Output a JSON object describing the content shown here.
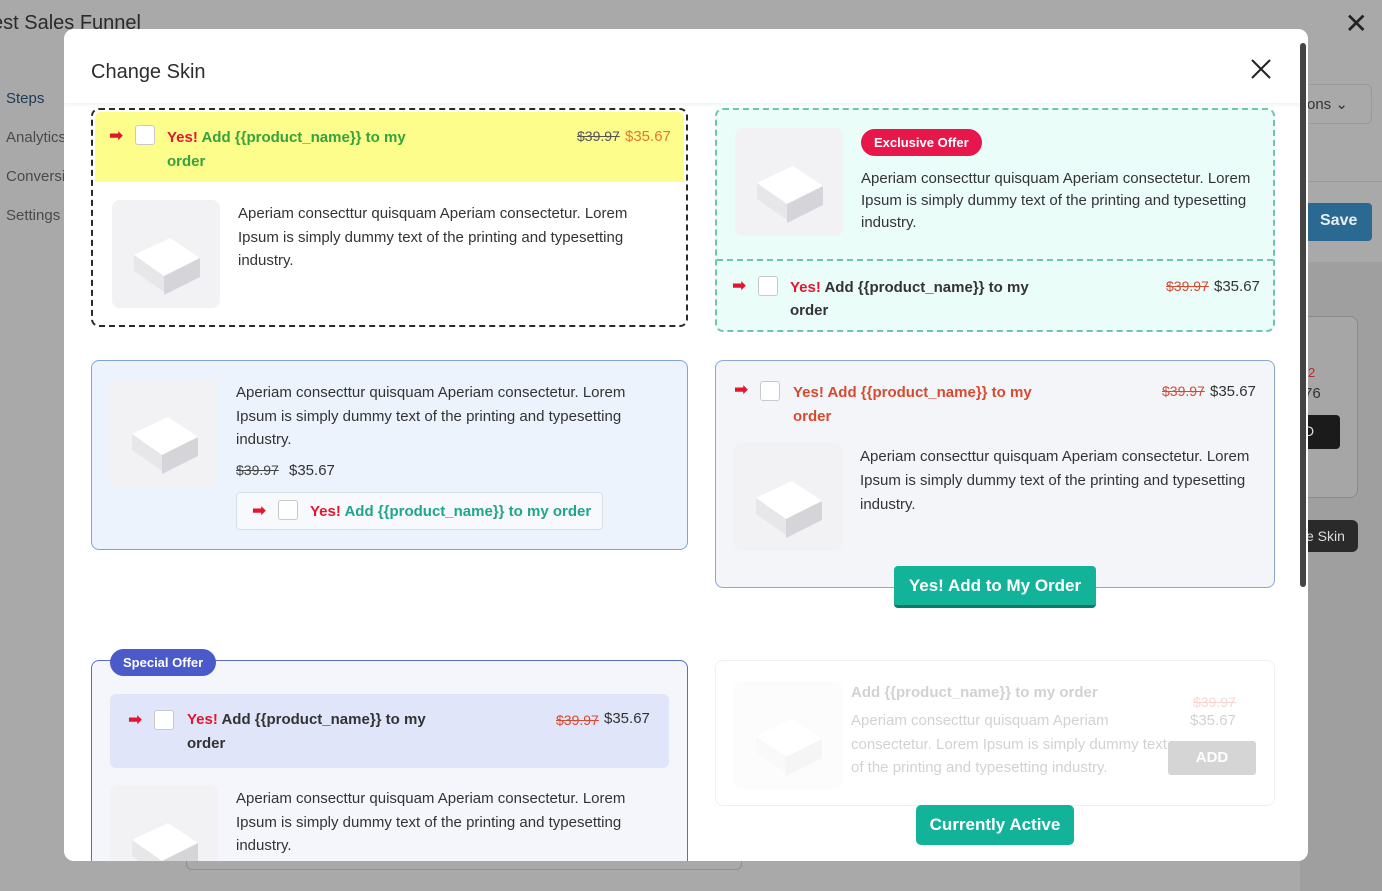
{
  "background": {
    "title": "est Sales Funnel",
    "nav": [
      "Steps",
      "Analytics",
      "Conversi",
      "Settings"
    ],
    "select_label": "ons",
    "save_label": "Save",
    "card_old_price": "2",
    "card_new_price": "76",
    "card_button": "D",
    "skin_button": "e Skin"
  },
  "modal": {
    "title": "Change Skin"
  },
  "skins": {
    "skin1": {
      "yes": "Yes!",
      "add_text": " Add {{product_name}} to my order",
      "old_price": "$39.97",
      "new_price": "$35.67",
      "description": "Aperiam consecttur quisquam Aperiam consectetur. Lorem Ipsum is simply dummy text of the printing and typesetting industry."
    },
    "skin2": {
      "badge": "Exclusive Offer",
      "description": "Aperiam consecttur quisquam Aperiam consectetur. Lorem Ipsum is simply dummy text of the printing and typesetting industry.",
      "yes": "Yes!",
      "add_text": " Add {{product_name}} to my order",
      "old_price": "$39.97",
      "new_price": "$35.67"
    },
    "skin3": {
      "description": "Aperiam consecttur quisquam Aperiam consectetur. Lorem Ipsum is simply dummy text of the printing and typesetting industry.",
      "old_price": "$39.97",
      "new_price": "$35.67",
      "yes": "Yes!",
      "add_text": " Add {{product_name}} to my order"
    },
    "skin4": {
      "add_text": "Yes! Add {{product_name}} to my order",
      "old_price": "$39.97",
      "new_price": "$35.67",
      "description": "Aperiam consecttur quisquam Aperiam consectetur. Lorem Ipsum is simply dummy text of the printing and typesetting industry.",
      "button": "Yes! Add to My Order"
    },
    "skin5": {
      "badge": "Special Offer",
      "yes": "Yes!",
      "add_text": " Add {{product_name}} to my order",
      "old_price": "$39.97",
      "new_price": "$35.67",
      "description": "Aperiam consecttur quisquam Aperiam consectetur. Lorem Ipsum is simply dummy text of the printing and typesetting industry."
    },
    "skin6": {
      "title": "Add {{product_name}} to my order",
      "description": "Aperiam consecttur quisquam Aperiam consectetur. Lorem Ipsum is simply dummy text of the printing and typesetting industry.",
      "old_price": "$39.97",
      "new_price": "$35.67",
      "add_button": "ADD",
      "status_button": "Currently Active"
    }
  },
  "colors": {
    "accent_green": "#13b39a",
    "arrow_red": "#e3152f",
    "exclusive_badge": "#e8174b",
    "special_badge": "#4a5bc9"
  }
}
